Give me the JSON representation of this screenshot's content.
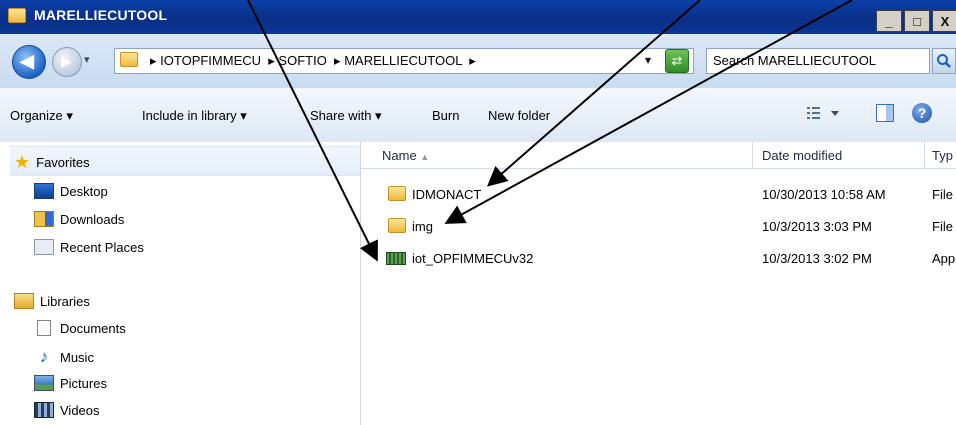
{
  "window": {
    "title": "MARELLIECUTOOL",
    "buttons": [
      "_",
      "□",
      "X"
    ]
  },
  "address_bar": {
    "segments": [
      "IOTOPFIMMECU",
      "SOFTIO",
      "MARELLIECUTOOL"
    ],
    "separator": "▸",
    "dropdown_glyph": "▾"
  },
  "search": {
    "placeholder": "Search MARELLIECUTOOL"
  },
  "toolbar": {
    "organize": "Organize ▾",
    "include_in_library": "Include in library ▾",
    "share_with": "Share with ▾",
    "burn": "Burn",
    "new_folder": "New folder"
  },
  "nav": {
    "favorites": "Favorites",
    "desktop": "Desktop",
    "downloads": "Downloads",
    "recent_places": "Recent Places",
    "libraries": "Libraries",
    "documents": "Documents",
    "music": "Music",
    "pictures": "Pictures",
    "videos": "Videos"
  },
  "columns": {
    "name": "Name",
    "date_modified": "Date modified",
    "type": "Typ"
  },
  "files": [
    {
      "name": "IDMONACT",
      "date": "10/30/2013 10:58 AM",
      "type": "File",
      "icon": "folder-icon"
    },
    {
      "name": "img",
      "date": "10/3/2013 3:03 PM",
      "type": "File",
      "icon": "folder-icon"
    },
    {
      "name": "iot_OPFIMMECUv32",
      "date": "10/3/2013 3:02 PM",
      "type": "App",
      "icon": "application-icon"
    }
  ],
  "colors": {
    "titlebar": "#0a2f86",
    "accent": "#1f5fbf",
    "folder": "#eeb93c",
    "arrow": "#000000"
  }
}
